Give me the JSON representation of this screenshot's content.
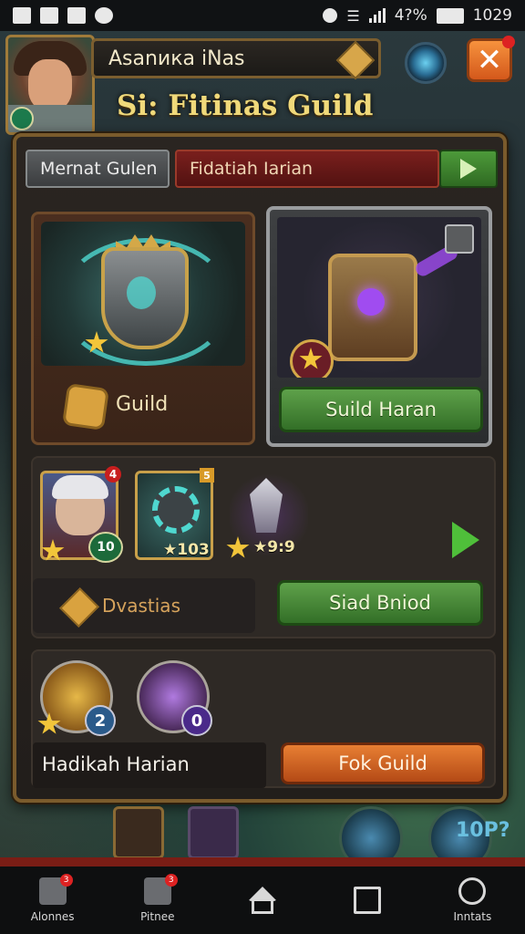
{
  "status_bar": {
    "battery": "4?%",
    "time": "1029"
  },
  "header": {
    "player_name": "Asanика iNas",
    "title": "Si: Fitinas Guild"
  },
  "tabs": {
    "tab_a": "Mernat Gulen",
    "tab_b": "Fidatiah Iarian"
  },
  "cards": {
    "guild_label": "Guild",
    "harian_button": "Suild Haran"
  },
  "rewards": {
    "items": [
      {
        "badge": "4",
        "count": "10"
      },
      {
        "badge": "5",
        "count": "★103"
      },
      {
        "badge": "",
        "count": "★9:9"
      }
    ],
    "bonus_label": "Dvastias",
    "button": "Siad Bniod"
  },
  "heroes": {
    "items": [
      {
        "level": "2"
      },
      {
        "level": "0"
      }
    ],
    "label": "Hadikah Harian",
    "button": "Fok Guild"
  },
  "background": {
    "corner_text": "10P?"
  },
  "nav": {
    "items": [
      {
        "label": "Alonnes",
        "badge": "3"
      },
      {
        "label": "Pitnee",
        "badge": "3"
      },
      {
        "label": ""
      },
      {
        "label": ""
      },
      {
        "label": "Inntats"
      }
    ]
  },
  "colors": {
    "frame_gold": "#7a5b2c",
    "button_green": "#5ea14a",
    "button_orange": "#e87f33",
    "tab_red": "#7a1f1d",
    "close_orange": "#f6923d"
  }
}
